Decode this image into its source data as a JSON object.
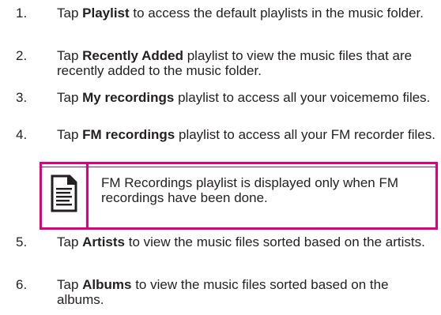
{
  "steps": [
    {
      "num": "1.",
      "pre": "Tap ",
      "bold": "Playlist",
      "post": " to access the default playlists in the music folder."
    },
    {
      "num": "2.",
      "pre": "Tap ",
      "bold": "Recently Added",
      "post": " playlist to view the music files that are recently added to the music folder."
    },
    {
      "num": "3.",
      "pre": "Tap ",
      "bold": "My recordings",
      "post": " playlist to access all your voicememo files."
    },
    {
      "num": "4.",
      "pre": "Tap ",
      "bold": "FM recordings",
      "post": " playlist to access all your FM recorder files."
    },
    {
      "num": "5.",
      "pre": "Tap ",
      "bold": "Artists",
      "post": " to view the music files sorted based on the artists."
    },
    {
      "num": "6.",
      "pre": "Tap ",
      "bold": "Albums",
      "post": " to view the music files sorted based on the albums."
    }
  ],
  "note": {
    "icon": "note-document-icon",
    "text": "FM Recordings playlist is displayed only when FM recordings have been done."
  },
  "colors": {
    "accent": "#e2007a",
    "text": "#231f20"
  }
}
